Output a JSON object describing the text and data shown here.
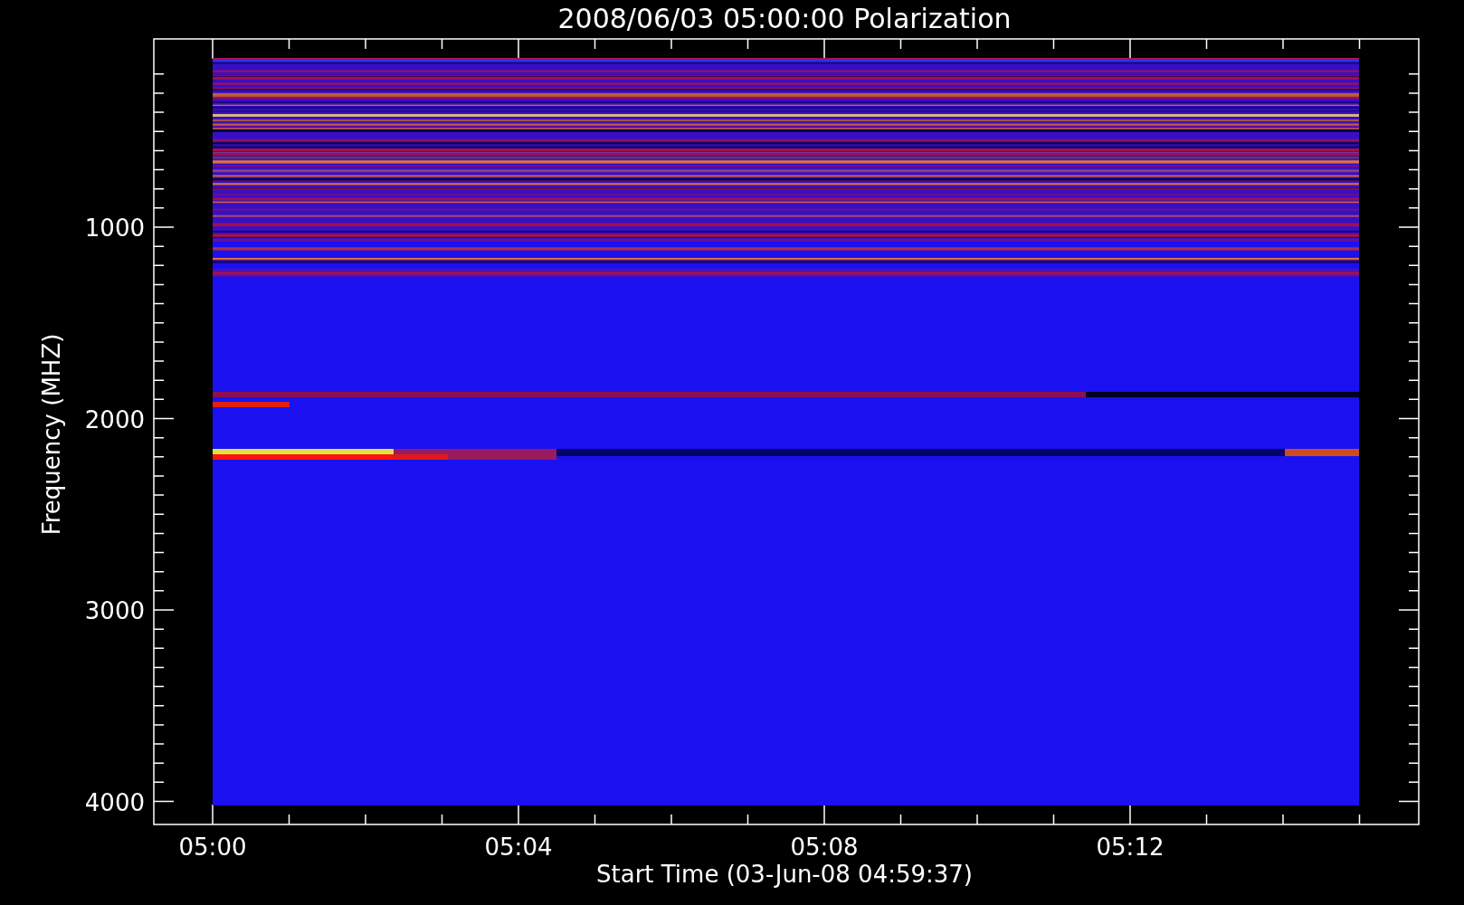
{
  "plot": {
    "title": "2008/06/03 05:00:00 Polarization",
    "ylabel": "Frequency (MHZ)",
    "xlabel": "Start Time (03-Jun-08 04:59:37)",
    "y_ticks": [
      "1000",
      "2000",
      "3000",
      "4000"
    ],
    "x_ticks": [
      "05:00",
      "05:04",
      "05:08",
      "05:12"
    ]
  }
}
